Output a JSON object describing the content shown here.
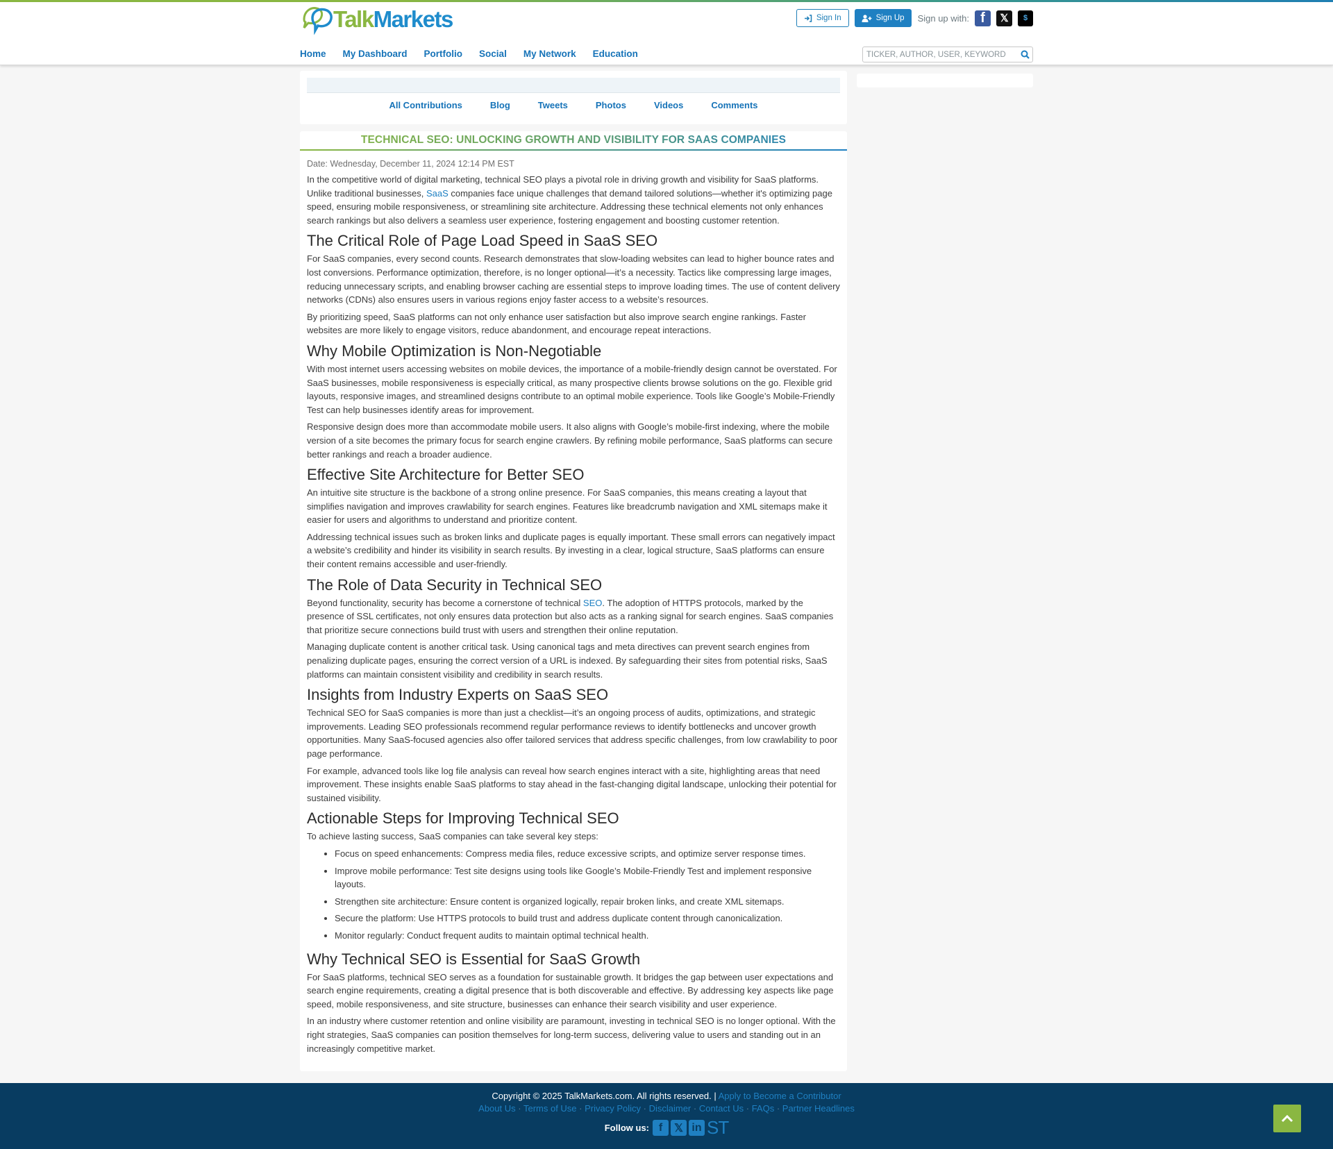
{
  "header": {
    "logo": {
      "part1": "Talk",
      "part2": "Markets"
    },
    "nav": [
      "Home",
      "My Dashboard",
      "Portfolio",
      "Social",
      "My Network",
      "Education"
    ],
    "sign_in_label": "Sign In",
    "sign_up_label": "Sign Up",
    "sign_up_with_label": "Sign up with:",
    "social_signup": [
      {
        "icon": "facebook-icon",
        "glyph": "f"
      },
      {
        "icon": "x-icon",
        "glyph": "𝕏"
      },
      {
        "icon": "stocktwits-icon",
        "glyph": "$"
      }
    ],
    "search": {
      "placeholder": "TICKER, AUTHOR, USER, KEYWORD",
      "value": ""
    }
  },
  "tabs": [
    "All Contributions",
    "Blog",
    "Tweets",
    "Photos",
    "Videos",
    "Comments"
  ],
  "article": {
    "title": "TECHNICAL SEO: UNLOCKING GROWTH AND VISIBILITY FOR SAAS COMPANIES",
    "date": "Date: Wednesday, December 11, 2024 12:14 PM EST",
    "intro": {
      "before": "In the competitive world of digital marketing, technical SEO plays a pivotal role in driving growth and visibility for SaaS platforms. Unlike traditional businesses, ",
      "link": "SaaS",
      "after": " companies face unique challenges that demand tailored solutions—whether it's optimizing page speed, ensuring mobile responsiveness, or streamlining site architecture. Addressing these technical elements not only enhances search rankings but also delivers a seamless user experience, fostering engagement and boosting customer retention."
    },
    "sections": [
      {
        "heading": "The Critical Role of Page Load Speed in SaaS SEO",
        "paragraphs": [
          "For SaaS companies, every second counts. Research demonstrates that slow-loading websites can lead to higher bounce rates and lost conversions. Performance optimization, therefore, is no longer optional—it’s a necessity. Tactics like compressing large images, reducing unnecessary scripts, and enabling browser caching are essential steps to improve loading times. The use of content delivery networks (CDNs) also ensures users in various regions enjoy faster access to a website’s resources.",
          "By prioritizing speed, SaaS platforms can not only enhance user satisfaction but also improve search engine rankings. Faster websites are more likely to engage visitors, reduce abandonment, and encourage repeat interactions."
        ]
      },
      {
        "heading": "Why Mobile Optimization is Non-Negotiable",
        "paragraphs": [
          "With most internet users accessing websites on mobile devices, the importance of a mobile-friendly design cannot be overstated. For SaaS businesses, mobile responsiveness is especially critical, as many prospective clients browse solutions on the go. Flexible grid layouts, responsive images, and streamlined designs contribute to an optimal mobile experience. Tools like Google’s Mobile-Friendly Test can help businesses identify areas for improvement.",
          "Responsive design does more than accommodate mobile users. It also aligns with Google’s mobile-first indexing, where the mobile version of a site becomes the primary focus for search engine crawlers. By refining mobile performance, SaaS platforms can secure better rankings and reach a broader audience."
        ]
      },
      {
        "heading": "Effective Site Architecture for Better SEO",
        "paragraphs": [
          "An intuitive site structure is the backbone of a strong online presence. For SaaS companies, this means creating a layout that simplifies navigation and improves crawlability for search engines. Features like breadcrumb navigation and XML sitemaps make it easier for users and algorithms to understand and prioritize content.",
          "Addressing technical issues such as broken links and duplicate pages is equally important. These small errors can negatively impact a website’s credibility and hinder its visibility in search results. By investing in a clear, logical structure, SaaS platforms can ensure their content remains accessible and user-friendly."
        ]
      },
      {
        "heading": "The Role of Data Security in Technical SEO",
        "linked_paragraph": {
          "before": "Beyond functionality, security has become a cornerstone of technical ",
          "link": "SEO",
          "after": ". The adoption of HTTPS protocols, marked by the presence of SSL certificates, not only ensures data protection but also acts as a ranking signal for search engines. SaaS companies that prioritize secure connections build trust with users and strengthen their online reputation."
        },
        "paragraphs": [
          "Managing duplicate content is another critical task. Using canonical tags and meta directives can prevent search engines from penalizing duplicate pages, ensuring the correct version of a URL is indexed. By safeguarding their sites from potential risks, SaaS platforms can maintain consistent visibility and credibility in search results."
        ]
      },
      {
        "heading": "Insights from Industry Experts on SaaS SEO",
        "paragraphs": [
          "Technical SEO for SaaS companies is more than just a checklist—it’s an ongoing process of audits, optimizations, and strategic improvements. Leading SEO professionals recommend regular performance reviews to identify bottlenecks and uncover growth opportunities. Many SaaS-focused agencies also offer tailored services that address specific challenges, from low crawlability to poor page performance.",
          "For example, advanced tools like log file analysis can reveal how search engines interact with a site, highlighting areas that need improvement. These insights enable SaaS platforms to stay ahead in the fast-changing digital landscape, unlocking their potential for sustained visibility."
        ]
      },
      {
        "heading": "Actionable Steps for Improving Technical SEO",
        "paragraphs": [
          "To achieve lasting success, SaaS companies can take several key steps:"
        ],
        "list": [
          "Focus on speed enhancements: Compress media files, reduce excessive scripts, and optimize server response times.",
          "Improve mobile performance: Test site designs using tools like Google’s Mobile-Friendly Test and implement responsive layouts.",
          "Strengthen site architecture: Ensure content is organized logically, repair broken links, and create XML sitemaps.",
          "Secure the platform: Use HTTPS protocols to build trust and address duplicate content through canonicalization.",
          "Monitor regularly: Conduct frequent audits to maintain optimal technical health."
        ]
      },
      {
        "heading": "Why Technical SEO is Essential for SaaS Growth",
        "paragraphs": [
          "For SaaS platforms, technical SEO serves as a foundation for sustainable growth. It bridges the gap between user expectations and search engine requirements, creating a digital presence that is both discoverable and effective. By addressing key aspects like page speed, mobile responsiveness, and site structure, businesses can enhance their search visibility and user experience.",
          "In an industry where customer retention and online visibility are paramount, investing in technical SEO is no longer optional. With the right strategies, SaaS companies can position themselves for long-term success, delivering value to users and standing out in an increasingly competitive market."
        ]
      }
    ]
  },
  "footer": {
    "copyright": "Copyright © 2025 TalkMarkets.com. All rights reserved. | ",
    "apply_link": "Apply to Become a Contributor",
    "links": [
      "About Us",
      "Terms of Use",
      "Privacy Policy",
      "Disclaimer",
      "Contact Us",
      "FAQs",
      "Partner Headlines"
    ],
    "separator": " · ",
    "follow_label": "Follow us:",
    "follow_icons": [
      {
        "icon": "facebook-icon",
        "glyph": "f"
      },
      {
        "icon": "x-icon",
        "glyph": "𝕏"
      },
      {
        "icon": "linkedin-icon",
        "glyph": "in"
      },
      {
        "icon": "stocktwits-icon",
        "glyph": "ST"
      }
    ]
  },
  "colors": {
    "brand_green": "#8ab742",
    "brand_blue": "#1f80c2",
    "nav_link": "#1673b8",
    "footer_bg": "#083c61"
  }
}
